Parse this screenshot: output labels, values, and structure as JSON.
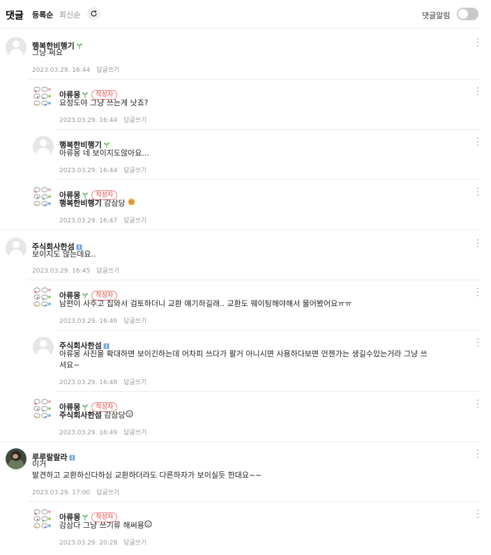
{
  "header": {
    "title": "댓글",
    "sort_recent": "등록순",
    "sort_latest": "최신순",
    "notify_label": "댓글알림",
    "notify_on": false
  },
  "reply_label": "답글쓰기",
  "writer_tag": "작성자",
  "comments": [
    {
      "nick": "행복한비행기",
      "badge": "sprout",
      "text": "그냥 써요",
      "date": "2023.03.29. 16:44"
    },
    {
      "nick": "아류몽",
      "badge": "sprout",
      "writer": true,
      "text": "요정도야 그냥 쓰는게 낫죠?",
      "date": "2023.03.29. 16:44"
    },
    {
      "nick": "행복한비행기",
      "badge": "sprout",
      "text": "아류몽 네 보이지도않아요...",
      "date": "2023.03.29. 16:44"
    },
    {
      "nick": "아류몽",
      "badge": "sprout",
      "writer": true,
      "mention": "행복한비행기",
      "text": " 감삼당",
      "date": "2023.03.29. 16:47"
    },
    {
      "nick": "주식회사한섬",
      "badge": "blue",
      "text": "보이지도 않는데요..",
      "date": "2023.03.29. 16:45"
    },
    {
      "nick": "아류몽",
      "badge": "sprout",
      "writer": true,
      "text": "남편이 사주고 집와서 검토하더니 교환 얘기하길래.. 교환도 웨이팅해야해서 물어봤어요ㅠㅠ",
      "date": "2023.03.29. 16:46"
    },
    {
      "nick": "주식회사한섬",
      "badge": "blue",
      "text_line1": "아류몽 사진을 확대하면 보이긴하는데 어차피 쓰다가 팔거 아니시면 사용하다보면 언젠가는 생길수있는거라 그냥 쓰",
      "text_line2": "셔요~",
      "date": "2023.03.29. 16:48"
    },
    {
      "nick": "아류몽",
      "badge": "sprout",
      "writer": true,
      "mention": "주식회사한섬",
      "text": " 감삼당",
      "date": "2023.03.29. 16:49"
    },
    {
      "nick": "루루랄랄라",
      "badge": "blue",
      "text_line1": "이거",
      "text_line2": "발견하고 교환하신다하심 교환하더라도 다른하자가 보이실듯 한대요~~",
      "date": "2023.03.29. 17:00"
    },
    {
      "nick": "아류몽",
      "badge": "sprout",
      "writer": true,
      "text": "감삼다 그냥 쓰기류 해써용",
      "date": "2023.03.29. 20:28"
    }
  ],
  "colors": {
    "accent_red": "#e2403a",
    "sprout_green": "#5cb85c",
    "badge_blue": "#7aa7e0"
  }
}
